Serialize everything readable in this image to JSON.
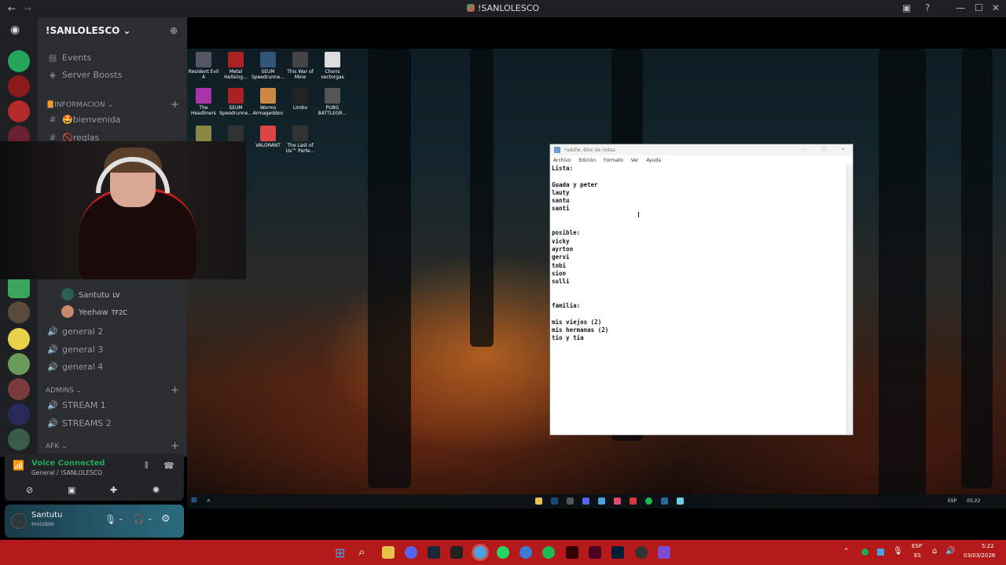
{
  "window": {
    "title": "!SANLOLESCO"
  },
  "server": {
    "name": "!SANLOLESCO"
  },
  "channels": {
    "events": "Events",
    "boosts": "Server Boosts",
    "cat_info": "📙INFORMACION",
    "bienvenida": "🤩bienvenida",
    "reglas": "🚫reglas",
    "voice_users": [
      {
        "name": "Santutu",
        "badge": "LV"
      },
      {
        "name": "Yeehaw",
        "badge": "TF2C"
      }
    ],
    "general2": "general 2",
    "general3": "general 3",
    "general4": "general 4",
    "cat_admins": "ADMINS",
    "stream1": "STREAM 1",
    "streams2": "STREAMS 2",
    "cat_afk": "AFK"
  },
  "voice": {
    "status": "Voice Connected",
    "channel": "General / !SANLOLESCO"
  },
  "user": {
    "name": "Santutu",
    "status": "Invisible"
  },
  "desktop_icons": [
    {
      "label": "Resident Evil 4",
      "color": "#556"
    },
    {
      "label": "Metal Hellsing...",
      "color": "#a22"
    },
    {
      "label": "SEUM Speedrunne...",
      "color": "#357"
    },
    {
      "label": "This War of Mine",
      "color": "#444"
    },
    {
      "label": "Choris vectorgas",
      "color": "#ddd"
    },
    {
      "label": "The Headliners",
      "color": "#a3a"
    },
    {
      "label": "SEUM Speedrunne...",
      "color": "#a22"
    },
    {
      "label": "Worms Armageddon",
      "color": "#c84"
    },
    {
      "label": "Limbo",
      "color": "#222"
    },
    {
      "label": "PUBG BATTLEGR...",
      "color": "#555"
    },
    {
      "label": "",
      "color": "#884"
    },
    {
      "label": "",
      "color": "#333"
    },
    {
      "label": "VALORANT",
      "color": "#d44"
    },
    {
      "label": "The Last of Us™ Parte...",
      "color": "#333"
    }
  ],
  "notepad": {
    "title": "*adsfw: Bloc de notas",
    "menu": [
      "Archivo",
      "Edición",
      "Formato",
      "Ver",
      "Ayuda"
    ],
    "content": "Lista:\n\nGuada y peter\nlauty\nsantu\nsanti\n\n\nposible:\nvicky\nayrton\ngervi\ntobi\nsion\nsulli\n\n\nfamilia:\n\nmis viejos (2)\nmis hermanas (2)\ntio y tia"
  },
  "inner_taskbar": {
    "lang": "ESP",
    "time": "05:22"
  },
  "outer_taskbar": {
    "lang": "ESP",
    "lang2": "ES",
    "time": "5:22",
    "date": "03/03/2026"
  }
}
